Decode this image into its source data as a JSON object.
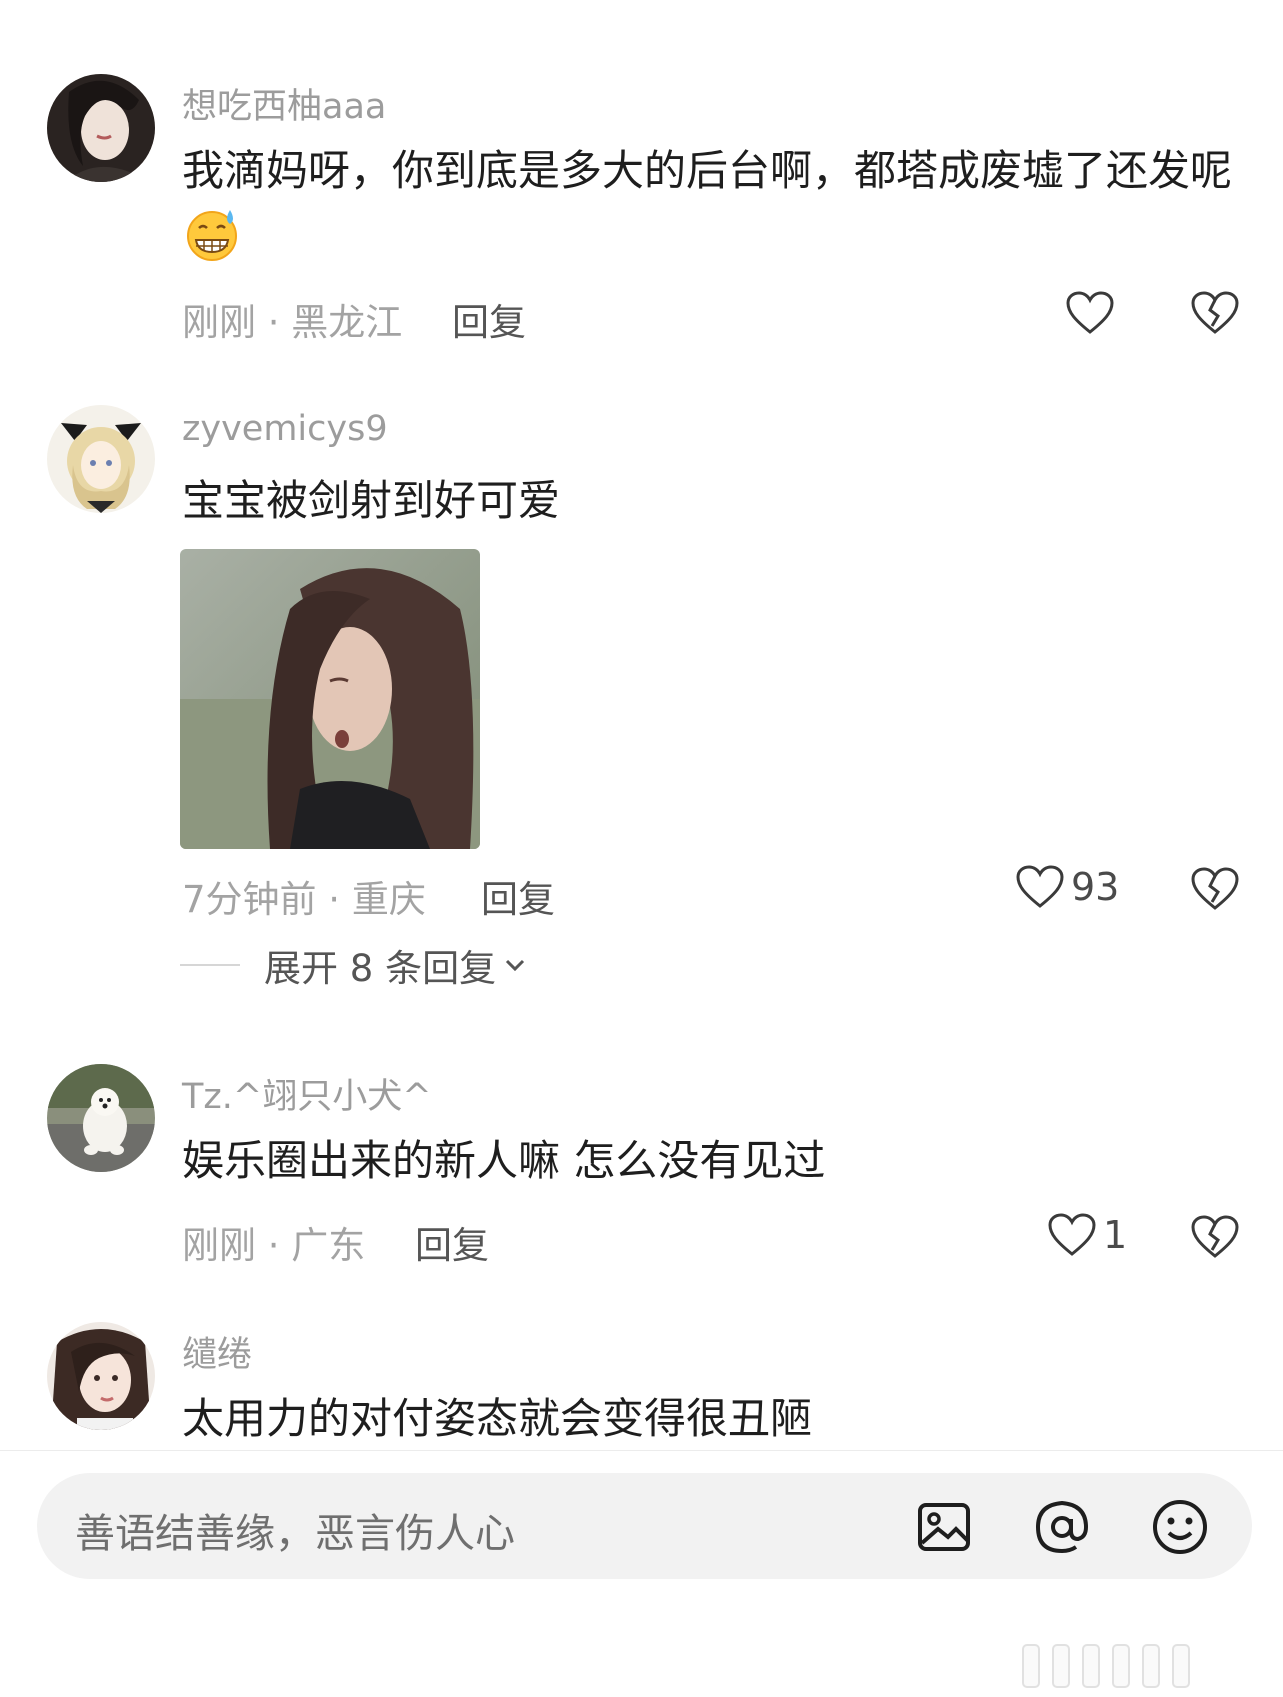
{
  "comments": [
    {
      "username": "想吃西柚aaa",
      "text": "我滴妈呀，你到底是多大的后台啊，都塔成废墟了还发呢",
      "emoji": "grimacing-sweat-emoji",
      "meta": "刚刚 · 黑龙江",
      "reply_label": "回复",
      "likes": ""
    },
    {
      "username": "zyvemicys9",
      "text": "宝宝被剑射到好可爱",
      "meta": "7分钟前 · 重庆",
      "reply_label": "回复",
      "likes": "93",
      "expand_label": "展开 8 条回复"
    },
    {
      "username": "Tz.^翊只小犬^",
      "text": "娱乐圈出来的新人嘛 怎么没有见过",
      "meta": "刚刚 · 广东",
      "reply_label": "回复",
      "likes": "1"
    },
    {
      "username": "缱绻",
      "text": "太用力的对付姿态就会变得很丑陋"
    }
  ],
  "input": {
    "placeholder": "善语结善缘，恶言伤人心"
  },
  "icons": {
    "like": "heart-outline-icon",
    "dislike": "broken-heart-icon",
    "image": "image-icon",
    "mention": "at-icon",
    "emoji": "smiley-icon",
    "expand": "chevron-down-icon"
  },
  "colors": {
    "username": "#9c9c9c",
    "meta": "#a3a3a3",
    "input_bg": "#f2f2f2"
  }
}
